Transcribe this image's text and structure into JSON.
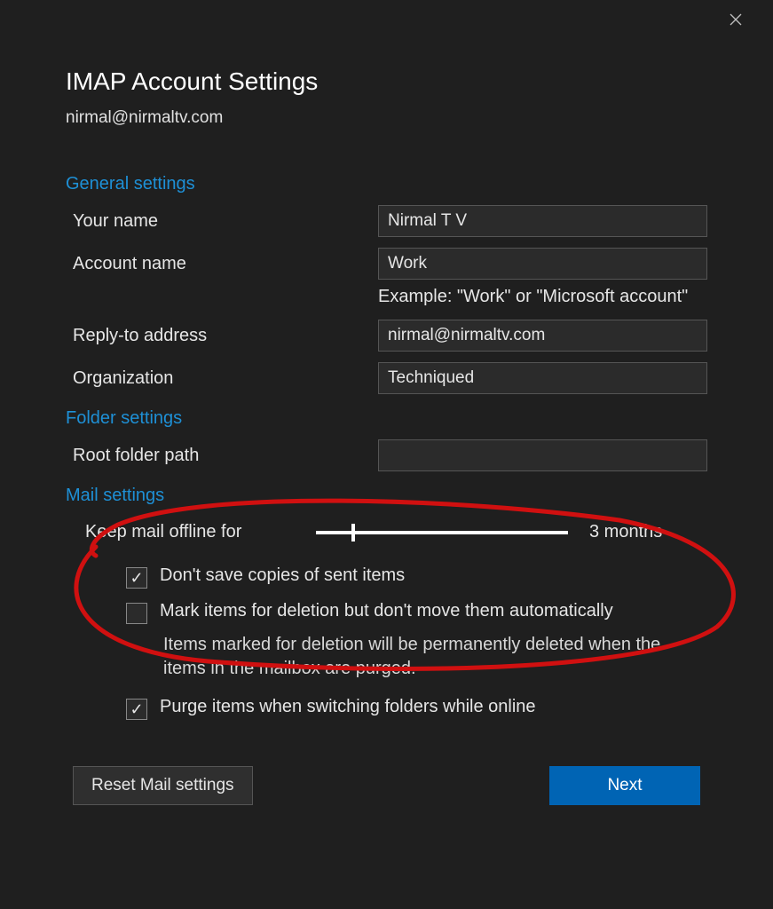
{
  "header": {
    "title": "IMAP Account Settings",
    "email": "nirmal@nirmaltv.com"
  },
  "sections": {
    "general": {
      "title": "General settings",
      "your_name_label": "Your name",
      "your_name_value": "Nirmal T V",
      "account_name_label": "Account name",
      "account_name_value": "Work",
      "example_hint": "Example: \"Work\" or \"Microsoft account\"",
      "reply_to_label": "Reply-to address",
      "reply_to_value": "nirmal@nirmaltv.com",
      "organization_label": "Organization",
      "organization_value": "Techniqued"
    },
    "folder": {
      "title": "Folder settings",
      "root_folder_label": "Root folder path",
      "root_folder_value": ""
    },
    "mail": {
      "title": "Mail settings",
      "keep_offline_label": "Keep mail offline for",
      "keep_offline_value": "3 months",
      "dont_save_sent_label": "Don't save copies of sent items",
      "dont_save_sent_checked": true,
      "mark_delete_label": "Mark items for deletion but don't move them automatically",
      "mark_delete_checked": false,
      "mark_delete_note": "Items marked for deletion will be permanently deleted when the items in the mailbox are purged.",
      "purge_label": "Purge items when switching folders while online",
      "purge_checked": true
    }
  },
  "buttons": {
    "reset": "Reset Mail settings",
    "next": "Next"
  },
  "annotation": {
    "color": "#d01010",
    "description": "hand-drawn-circle-around-mail-settings"
  }
}
